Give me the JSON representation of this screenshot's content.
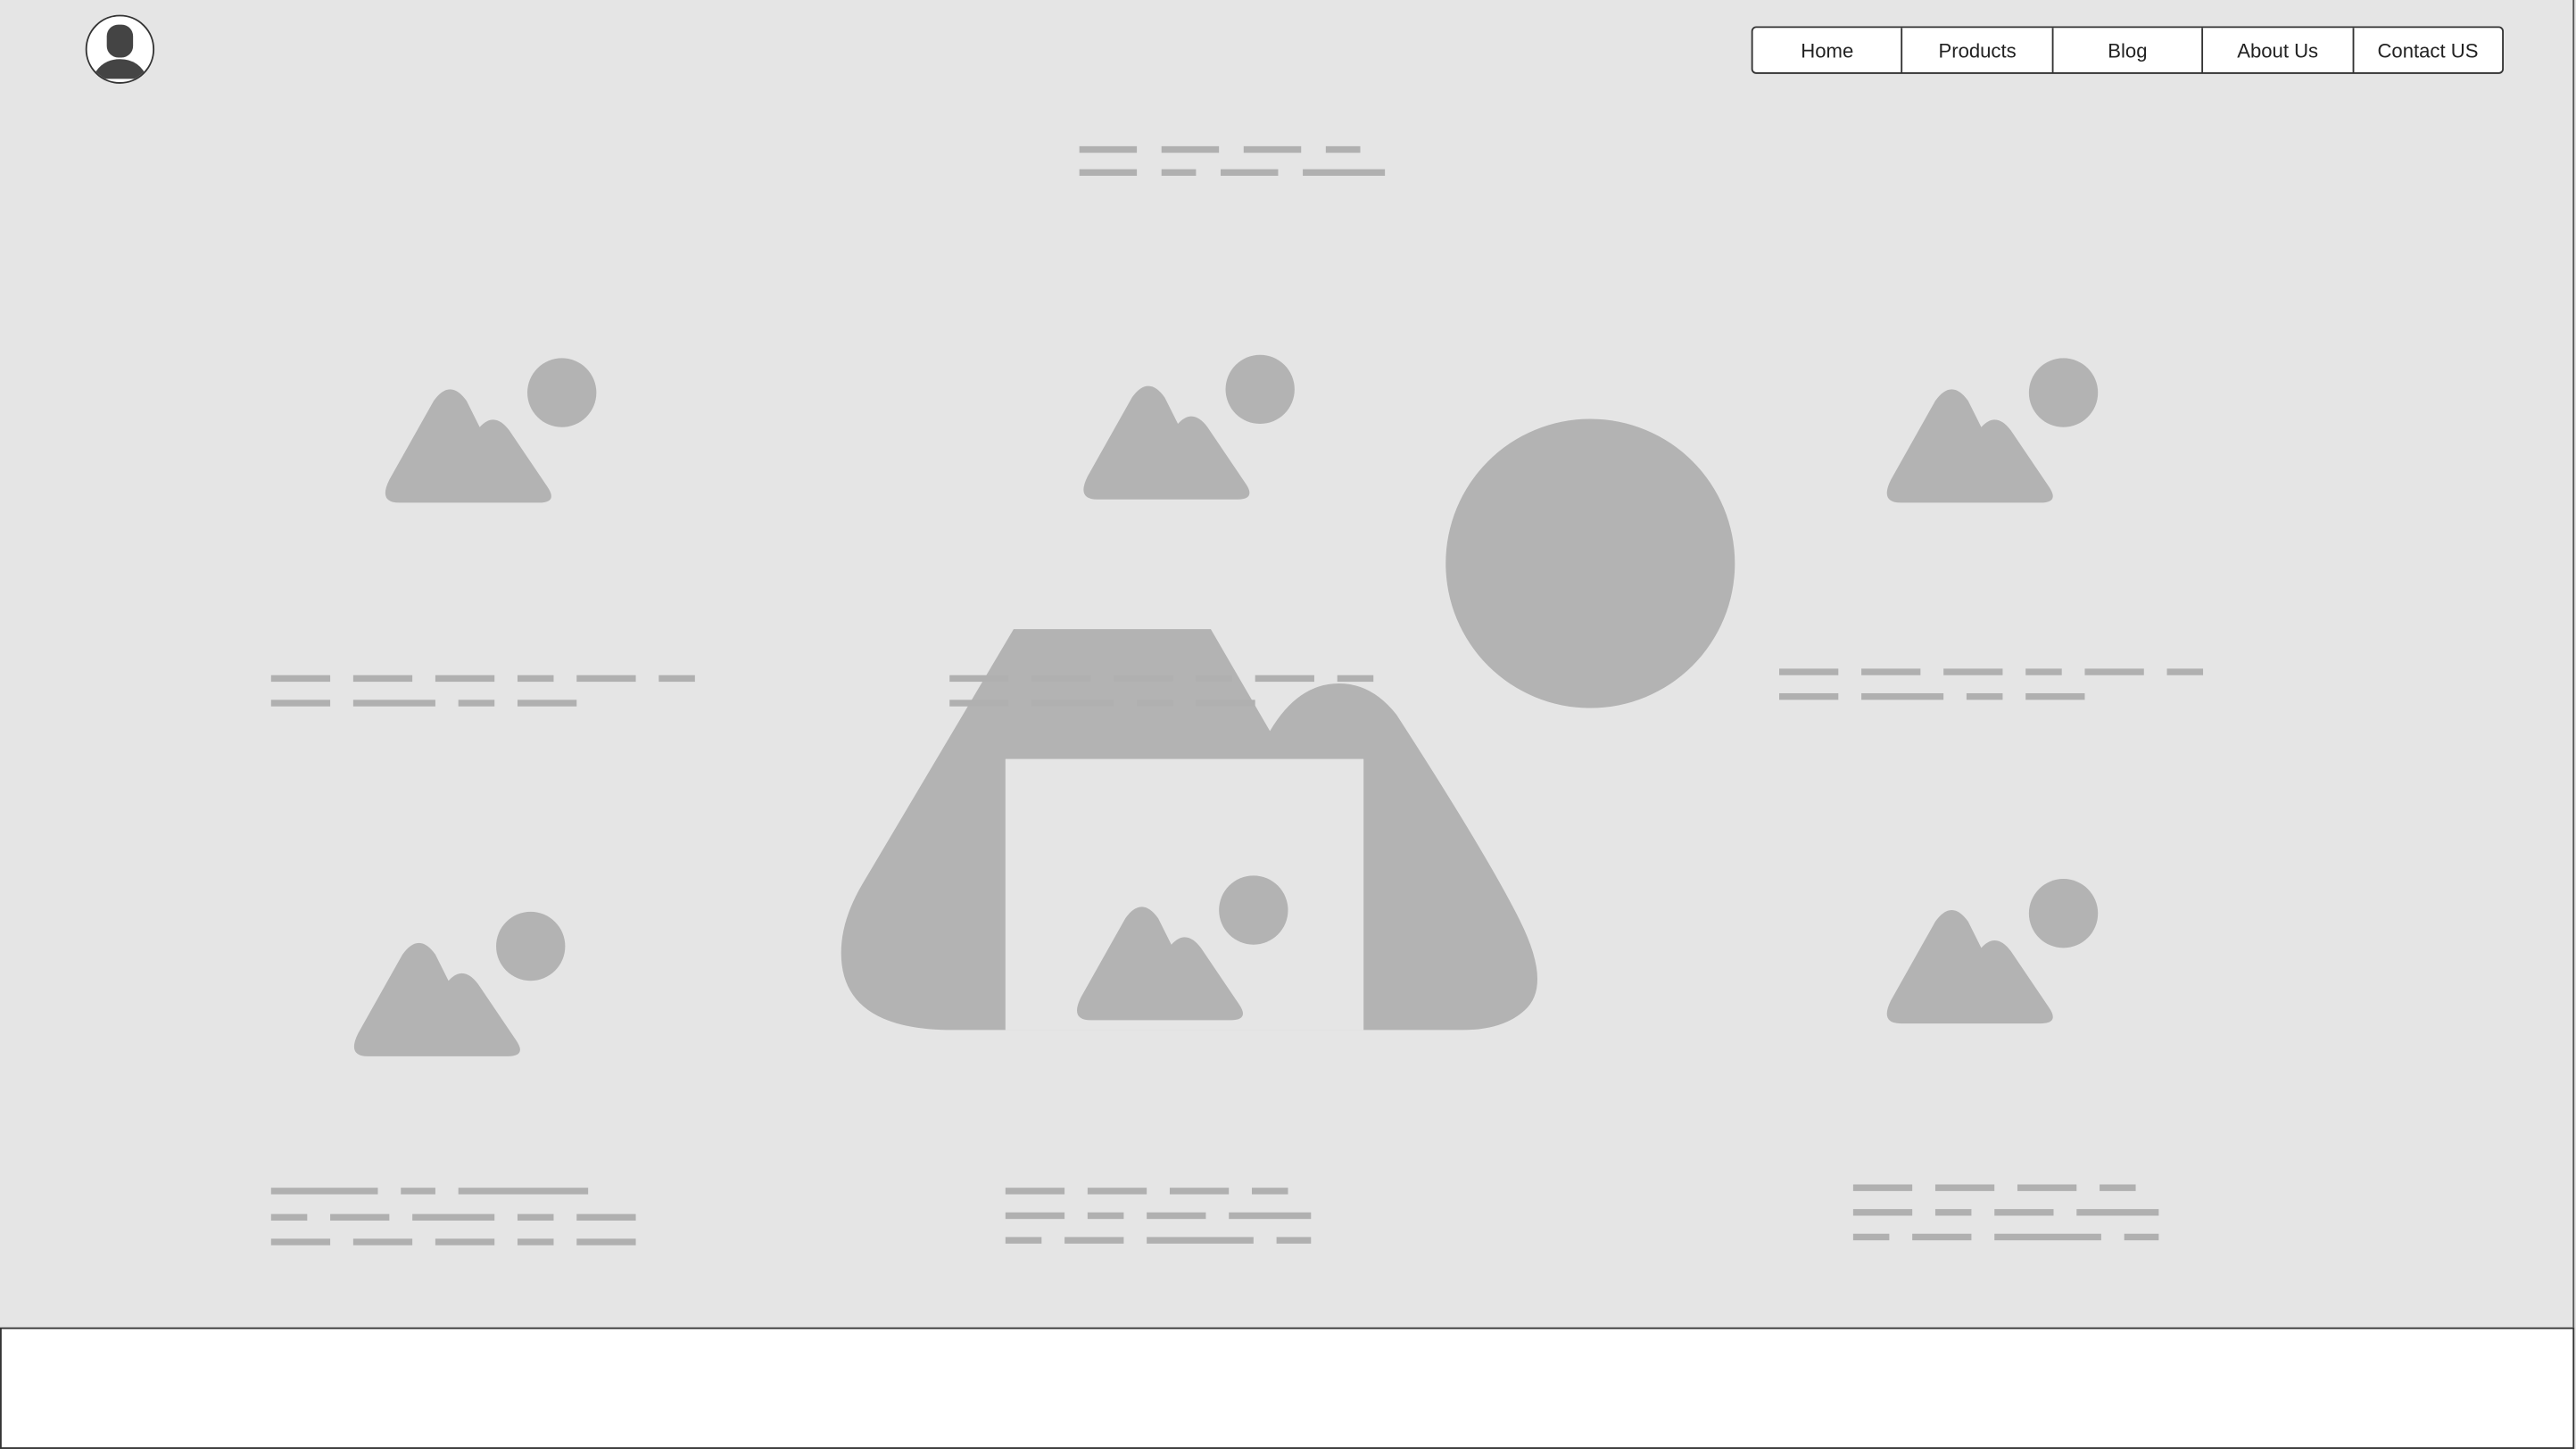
{
  "header": {
    "avatar_icon": "user-avatar-icon",
    "nav": [
      {
        "label": "Home"
      },
      {
        "label": "Products"
      },
      {
        "label": "Blog"
      },
      {
        "label": "About Us"
      },
      {
        "label": "Contact US"
      }
    ]
  },
  "colors": {
    "background": "#e5e5e5",
    "placeholder": "#b3b3b3",
    "border": "#333333"
  },
  "content": {
    "image_placeholder_icon": "image-icon",
    "image_placeholder_count": 6,
    "hero_image_icon": "image-icon"
  }
}
